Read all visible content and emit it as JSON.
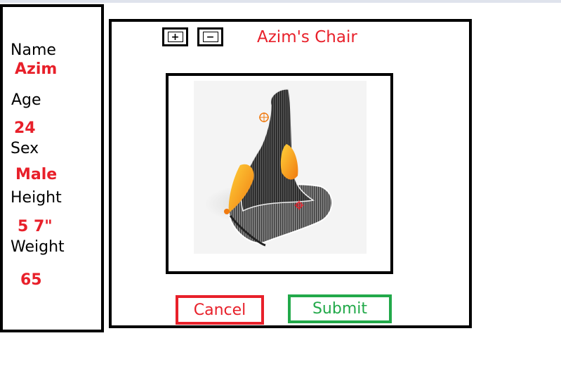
{
  "profile": {
    "name_label": "Name",
    "name_value": "Azim",
    "age_label": "Age",
    "age_value": "24",
    "sex_label": "Sex",
    "sex_value": "Male",
    "height_label": "Height",
    "height_value": "5 7\"",
    "weight_label": "Weight",
    "weight_value": "65"
  },
  "toolbar": {
    "zoom_in_label": "+",
    "zoom_out_label": "−"
  },
  "main": {
    "title": "Azim's Chair"
  },
  "actions": {
    "cancel_label": "Cancel",
    "submit_label": "Submit"
  },
  "colors": {
    "accent_red": "#e8202a",
    "accent_green": "#22a94a",
    "chair_orange": "#f59a1a"
  }
}
